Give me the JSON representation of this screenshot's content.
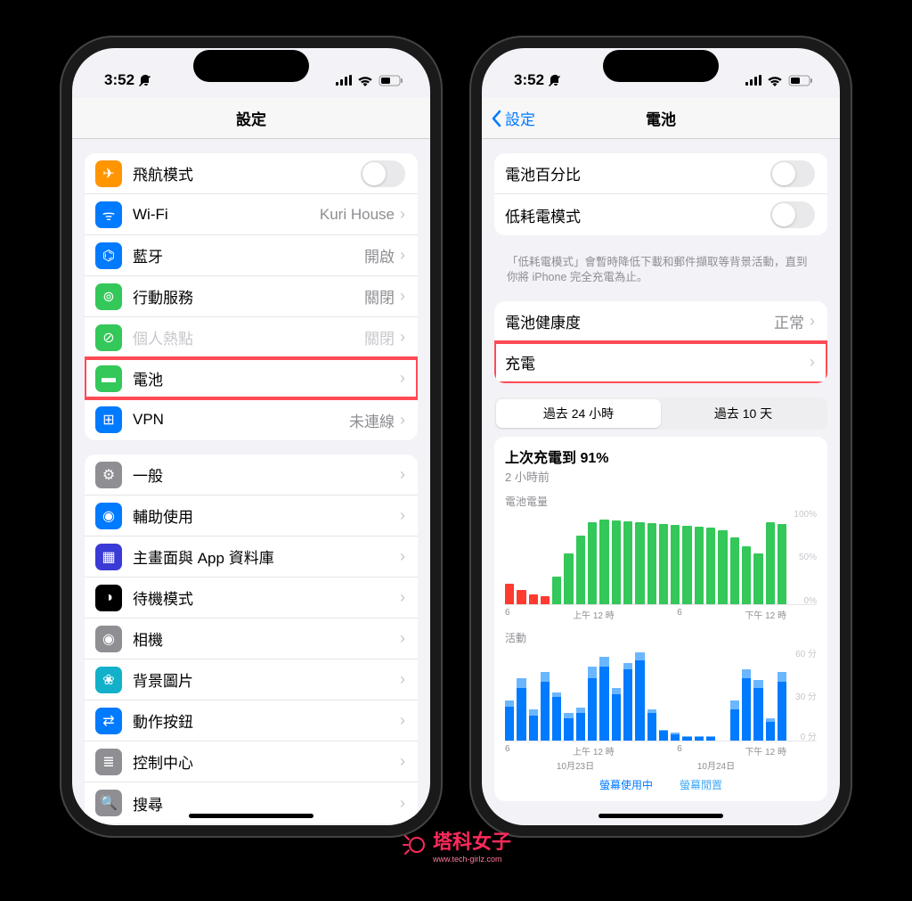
{
  "status": {
    "time": "3:52",
    "bell": "🔕"
  },
  "left": {
    "title": "設定",
    "rows_g1": [
      {
        "icon": "airplane-icon",
        "bg": "#ff9500",
        "label": "飛航模式",
        "type": "toggle"
      },
      {
        "icon": "wifi-icon",
        "bg": "#007aff",
        "label": "Wi-Fi",
        "value": "Kuri House",
        "type": "link"
      },
      {
        "icon": "bluetooth-icon",
        "bg": "#007aff",
        "label": "藍牙",
        "value": "開啟",
        "type": "link"
      },
      {
        "icon": "cellular-icon",
        "bg": "#34c759",
        "label": "行動服務",
        "value": "關閉",
        "type": "link"
      },
      {
        "icon": "hotspot-icon",
        "bg": "#34c759",
        "label": "個人熱點",
        "value": "關閉",
        "type": "link",
        "dim": true
      },
      {
        "icon": "battery-icon",
        "bg": "#34c759",
        "label": "電池",
        "type": "link",
        "highlight": true
      },
      {
        "icon": "vpn-icon",
        "bg": "#007aff",
        "label": "VPN",
        "value": "未連線",
        "type": "link"
      }
    ],
    "rows_g2": [
      {
        "icon": "gear-icon",
        "bg": "#8e8e93",
        "label": "一般",
        "type": "link"
      },
      {
        "icon": "accessibility-icon",
        "bg": "#007aff",
        "label": "輔助使用",
        "type": "link"
      },
      {
        "icon": "apps-icon",
        "bg": "#3a3ad6",
        "label": "主畫面與 App 資料庫",
        "type": "link"
      },
      {
        "icon": "standby-icon",
        "bg": "#000000",
        "label": "待機模式",
        "type": "link"
      },
      {
        "icon": "camera-icon",
        "bg": "#8e8e93",
        "label": "相機",
        "type": "link"
      },
      {
        "icon": "wallpaper-icon",
        "bg": "#12b1c9",
        "label": "背景圖片",
        "type": "link"
      },
      {
        "icon": "action-icon",
        "bg": "#007aff",
        "label": "動作按鈕",
        "type": "link"
      },
      {
        "icon": "control-icon",
        "bg": "#8e8e93",
        "label": "控制中心",
        "type": "link"
      },
      {
        "icon": "search-icon",
        "bg": "#8e8e93",
        "label": "搜尋",
        "type": "link"
      }
    ]
  },
  "right": {
    "back": "設定",
    "title": "電池",
    "rows_g1": [
      {
        "label": "電池百分比",
        "type": "toggle"
      },
      {
        "label": "低耗電模式",
        "type": "toggle"
      }
    ],
    "footnote": "「低耗電模式」會暫時降低下載和郵件擷取等背景活動，直到你將 iPhone 完全充電為止。",
    "rows_g2": [
      {
        "label": "電池健康度",
        "value": "正常",
        "type": "link"
      },
      {
        "label": "充電",
        "type": "link",
        "highlight": true
      }
    ],
    "seg": {
      "a": "過去 24 小時",
      "b": "過去 10 天"
    },
    "last_charge_title": "上次充電到 91%",
    "last_charge_sub": "2 小時前",
    "chart1_title": "電池電量",
    "chart2_title": "活動",
    "yticks_pct": [
      "100%",
      "50%",
      "0%"
    ],
    "yticks_min": [
      "60 分",
      "30 分",
      "0 分"
    ],
    "xticks": [
      "6",
      "上午 12 時",
      "6",
      "下午 12 時"
    ],
    "xdates": [
      "10月23日",
      "10月24日"
    ],
    "legend": {
      "on": "螢幕使用中",
      "idle": "螢幕閒置"
    }
  },
  "watermark": {
    "text": "塔科女子",
    "sub": "www.tech-girlz.com"
  },
  "chart_data": [
    {
      "type": "bar",
      "title": "電池電量",
      "ylabel": "%",
      "ylim": [
        0,
        100
      ],
      "x": [
        "18",
        "19",
        "20",
        "21",
        "22",
        "23",
        "0",
        "1",
        "2",
        "3",
        "4",
        "5",
        "6",
        "7",
        "8",
        "9",
        "10",
        "11",
        "12",
        "13",
        "14",
        "15",
        "16",
        "17"
      ],
      "series": [
        {
          "name": "level",
          "values": [
            22,
            15,
            10,
            8,
            30,
            55,
            74,
            88,
            91,
            90,
            89,
            88,
            87,
            86,
            85,
            84,
            83,
            82,
            80,
            72,
            62,
            55,
            88,
            86
          ],
          "colors": [
            "red",
            "red",
            "red",
            "red",
            "green",
            "green",
            "green",
            "green",
            "green",
            "green",
            "green",
            "green",
            "green",
            "green",
            "green",
            "green",
            "green",
            "green",
            "green",
            "green",
            "green",
            "green",
            "green",
            "green"
          ]
        }
      ]
    },
    {
      "type": "bar",
      "title": "活動",
      "ylabel": "分",
      "ylim": [
        0,
        60
      ],
      "x": [
        "18",
        "19",
        "20",
        "21",
        "22",
        "23",
        "0",
        "1",
        "2",
        "3",
        "4",
        "5",
        "6",
        "7",
        "8",
        "9",
        "10",
        "11",
        "12",
        "13",
        "14",
        "15",
        "16",
        "17"
      ],
      "series": [
        {
          "name": "螢幕使用中",
          "values": [
            22,
            34,
            16,
            38,
            28,
            14,
            18,
            40,
            48,
            30,
            46,
            52,
            18,
            6,
            4,
            2,
            2,
            2,
            0,
            20,
            40,
            34,
            12,
            38
          ]
        },
        {
          "name": "螢幕閒置",
          "values": [
            4,
            6,
            4,
            6,
            3,
            4,
            3,
            8,
            6,
            4,
            4,
            5,
            2,
            1,
            1,
            1,
            1,
            1,
            0,
            6,
            6,
            5,
            2,
            6
          ]
        }
      ]
    }
  ]
}
